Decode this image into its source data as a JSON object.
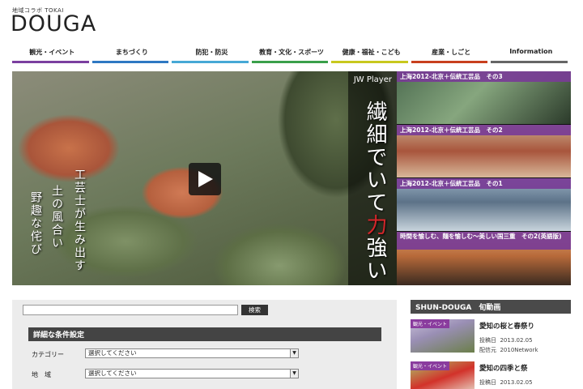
{
  "header": {
    "logo_sub": "地域コラボ TOKAI",
    "logo_main": "DOUGA"
  },
  "nav": {
    "items": [
      {
        "label": "観光・イベント",
        "color": "#7b3fa0"
      },
      {
        "label": "まちづくり",
        "color": "#2e78c2"
      },
      {
        "label": "防犯・防災",
        "color": "#46a8d6"
      },
      {
        "label": "教育・文化・スポーツ",
        "color": "#3aa04a"
      },
      {
        "label": "健康・福祉・こども",
        "color": "#c8c81e"
      },
      {
        "label": "産業・しごと",
        "color": "#c8401e"
      },
      {
        "label": "Information",
        "color": "#666666"
      }
    ]
  },
  "player": {
    "brand": "JW Player",
    "overlay_text_1a": "繊細でいて",
    "overlay_text_1b": "力",
    "overlay_text_1c": "強い",
    "overlay_text_2": "工芸士が生み出す",
    "overlay_text_3": "土の風合い",
    "overlay_text_4": "野趣な侘び"
  },
  "playlist": {
    "items": [
      {
        "title": "上海2012-北京＋伝統工芸品　その3"
      },
      {
        "title": "上海2012-北京＋伝統工芸品　その2"
      },
      {
        "title": "上海2012-北京＋伝統工芸品　その1"
      },
      {
        "title": "時間を愉しむ、麺を愉しむ～美しい国三重　その2(英語版)"
      }
    ]
  },
  "search": {
    "input_value": "",
    "button_label": "検索"
  },
  "filter": {
    "heading": "詳細な条件設定",
    "rows": [
      {
        "label": "カテゴリー",
        "selected": "選択してください"
      },
      {
        "label": "地　域",
        "selected": "選択してください"
      }
    ]
  },
  "shun": {
    "heading": "SHUN-DOUGA　旬動画",
    "items": [
      {
        "tag": "観光・イベント",
        "title": "愛知の桜と春祭り",
        "date_label": "投稿日",
        "date": "2013.02.05",
        "source_label": "配信元",
        "source": "2010Network"
      },
      {
        "tag": "観光・イベント",
        "title": "愛知の四季と祭",
        "date_label": "投稿日",
        "date": "2013.02.05"
      }
    ]
  },
  "colors": {
    "accent_purple": "#7b3fa0",
    "dark_header": "#444444"
  }
}
